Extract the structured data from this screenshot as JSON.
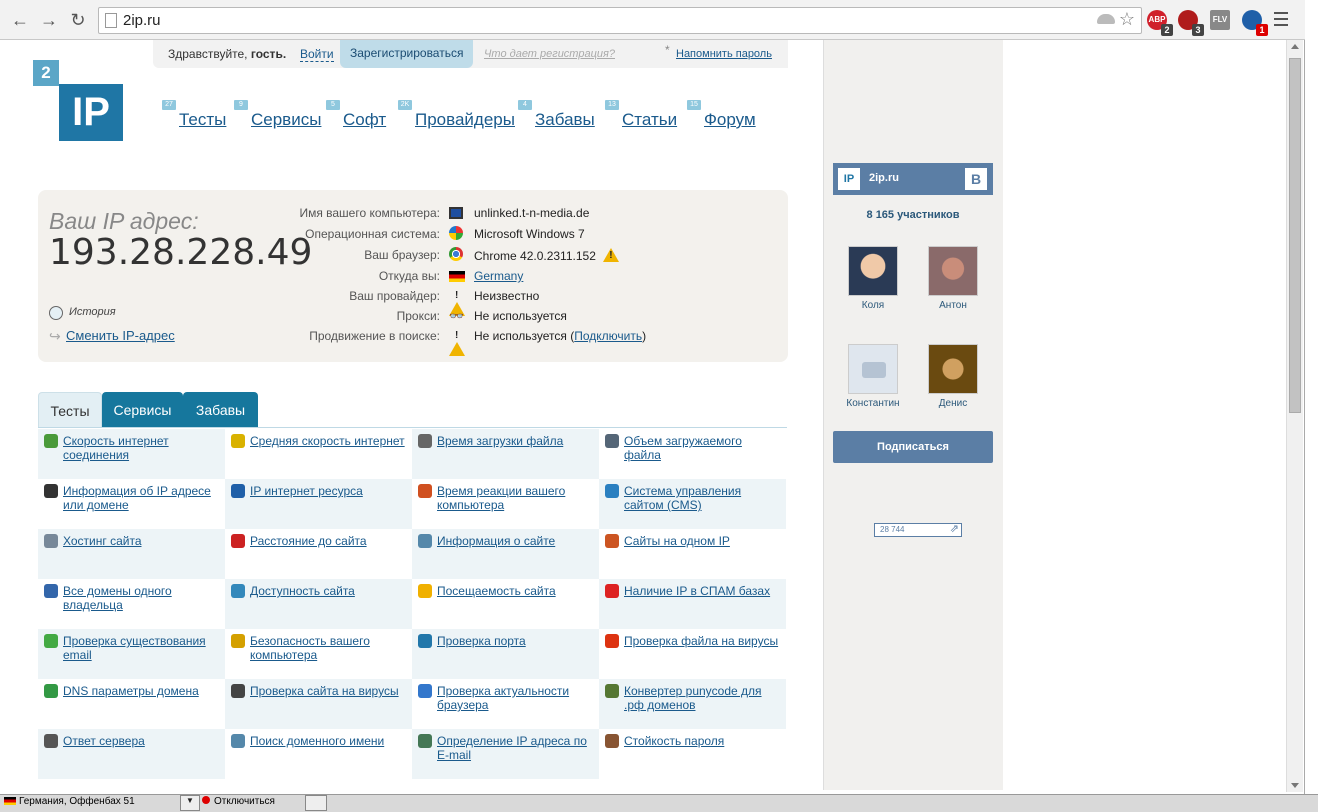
{
  "browser": {
    "url": "2ip.ru",
    "extensions": [
      {
        "name": "adblock-icon",
        "label": "ABP",
        "badge": "2",
        "color": "#d0202b"
      },
      {
        "name": "ublock-icon",
        "label": "",
        "badge": "3",
        "color": "#b01c1c"
      },
      {
        "name": "flv-icon",
        "label": "FLV",
        "badge": "",
        "color": "#888888"
      },
      {
        "name": "globe-ext-icon",
        "label": "",
        "badge": "1",
        "color": "#1f5fa8"
      }
    ]
  },
  "topbar": {
    "greeting": "Здравствуйте,",
    "guest": "гость.",
    "login": "Войти",
    "register": "Зарегистрироваться",
    "why": "Что дает регистрация?",
    "remind_star": "*",
    "remind": "Напомнить пароль"
  },
  "logo": {
    "two": "2",
    "ip": "IP"
  },
  "nav": [
    {
      "label": "Тесты",
      "count": "27"
    },
    {
      "label": "Сервисы",
      "count": "9"
    },
    {
      "label": "Софт",
      "count": "5"
    },
    {
      "label": "Провайдеры",
      "count": "2K"
    },
    {
      "label": "Забавы",
      "count": "4"
    },
    {
      "label": "Статьи",
      "count": "13"
    },
    {
      "label": "Форум",
      "count": "15"
    }
  ],
  "ipbox": {
    "label": "Ваш IP адрес:",
    "address": "193.28.228.49",
    "history": "История",
    "change": "Сменить IP-адрес",
    "rows": [
      {
        "key": "Имя вашего компьютера:",
        "value": "unlinked.t-n-media.de",
        "icon": "computer-icon"
      },
      {
        "key": "Операционная система:",
        "value": "Microsoft Windows 7",
        "icon": "windows-icon"
      },
      {
        "key": "Ваш браузер:",
        "value": "Chrome 42.0.2311.152",
        "icon": "chrome-icon"
      },
      {
        "key": "Откуда вы:",
        "value": "Germany",
        "icon": "germany-flag-icon"
      },
      {
        "key": "Ваш провайдер:",
        "value": "Неизвестно",
        "icon": "warning-icon"
      },
      {
        "key": "Прокси:",
        "value": "Не используется",
        "icon": "glasses-icon"
      },
      {
        "key": "Продвижение в поиске:",
        "value": "Не используется (",
        "link": "Подключить",
        "after": ")",
        "icon": "warning-icon"
      }
    ]
  },
  "tabs": [
    "Тесты",
    "Сервисы",
    "Забавы"
  ],
  "tests": [
    [
      "Скорость интернет соединения",
      "Средняя скорость интернет",
      "Время загрузки файла",
      "Объем загружаемого файла"
    ],
    [
      "Информация об IP адресе или домене",
      "IP интернет ресурса",
      "Время реакции вашего компьютера",
      "Система управления сайтом (CMS)"
    ],
    [
      "Хостинг сайта",
      "Расстояние до сайта",
      "Информация о сайте",
      "Сайты на одном IP"
    ],
    [
      "Все домены одного владельца",
      "Доступность сайта",
      "Посещаемость сайта",
      "Наличие IP в СПАМ базах"
    ],
    [
      "Проверка существования email",
      "Безопасность вашего компьютера",
      "Проверка порта",
      "Проверка файла на вирусы"
    ],
    [
      "DNS параметры домена",
      "Проверка сайта на вирусы",
      "Проверка актуальности браузера",
      "Конвертер punycode для .рф доменов"
    ],
    [
      "Ответ сервера",
      "Поиск доменного имени",
      "Определение IP адреса по E-mail",
      "Стойкость пароля"
    ]
  ],
  "test_icon_colors": [
    [
      "#4a9a3a",
      "#d9b200",
      "#666666",
      "#556677"
    ],
    [
      "#333333",
      "#1f5fa8",
      "#d05020",
      "#2a7fc0"
    ],
    [
      "#778899",
      "#cc2222",
      "#5588aa",
      "#cc5522"
    ],
    [
      "#3366aa",
      "#3388bb",
      "#f0b000",
      "#dd2222"
    ],
    [
      "#44aa44",
      "#d4a000",
      "#2277aa",
      "#dd3311"
    ],
    [
      "#339944",
      "#444444",
      "#3377cc",
      "#557733"
    ],
    [
      "#555555",
      "#5588aa",
      "#447755",
      "#885533"
    ]
  ],
  "vk": {
    "name": "2ip.ru",
    "vk_letter": "В",
    "members": "8 165 участников",
    "people": [
      "Коля",
      "Антон",
      "Константин",
      "Денис"
    ],
    "subscribe": "Подписаться"
  },
  "counter": "28 744",
  "taskbar": {
    "item1": "Германия, Оффенбах 51",
    "item2": "Отключиться"
  }
}
